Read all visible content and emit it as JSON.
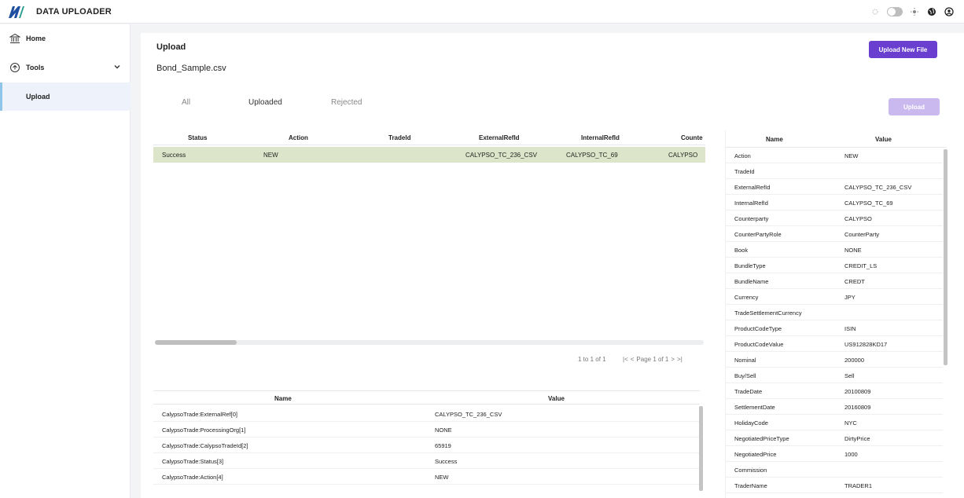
{
  "app": {
    "title": "DATA UPLOADER"
  },
  "sidebar": {
    "items": [
      {
        "label": "Home",
        "icon": "home-icon"
      },
      {
        "label": "Tools",
        "icon": "tools-icon"
      },
      {
        "label": "Upload",
        "active": true
      }
    ]
  },
  "page": {
    "title": "Upload",
    "file_name": "Bond_Sample.csv",
    "upload_new_label": "Upload New File",
    "upload_label": "Upload"
  },
  "tabs": [
    {
      "label": "All"
    },
    {
      "label": "Uploaded",
      "active": true
    },
    {
      "label": "Rejected"
    }
  ],
  "grid": {
    "columns": [
      "Status",
      "Action",
      "TradeId",
      "ExternalRefId",
      "InternalRefId",
      "Counte"
    ],
    "rows": [
      {
        "status": "Success",
        "action": "NEW",
        "trade_id": "",
        "external_ref": "CALYPSO_TC_236_CSV",
        "internal_ref": "CALYPSO_TC_69",
        "counterparty": "CALYPSO"
      }
    ]
  },
  "pager": {
    "count_text": "1 to 1 of 1",
    "first": "|<",
    "prev": "<",
    "page_text": "Page 1 of 1",
    "next": ">",
    "last": ">|"
  },
  "detail_table": {
    "headers": [
      "Name",
      "Value"
    ],
    "rows": [
      {
        "name": "CalypsoTrade:ExternalRef[0]",
        "value": "CALYPSO_TC_236_CSV"
      },
      {
        "name": "CalypsoTrade:ProcessingOrg[1]",
        "value": "NONE"
      },
      {
        "name": "CalypsoTrade:CalypsoTradeId[2]",
        "value": "65919"
      },
      {
        "name": "CalypsoTrade:Status[3]",
        "value": "Success"
      },
      {
        "name": "CalypsoTrade:Action[4]",
        "value": "NEW"
      }
    ]
  },
  "properties": {
    "headers": [
      "Name",
      "Value"
    ],
    "rows": [
      {
        "name": "Action",
        "value": "NEW"
      },
      {
        "name": "TradeId",
        "value": ""
      },
      {
        "name": "ExternalRefId",
        "value": "CALYPSO_TC_236_CSV"
      },
      {
        "name": "InternalRefId",
        "value": "CALYPSO_TC_69"
      },
      {
        "name": "Counterparty",
        "value": "CALYPSO"
      },
      {
        "name": "CounterPartyRole",
        "value": "CounterParty"
      },
      {
        "name": "Book",
        "value": "NONE"
      },
      {
        "name": "BundleType",
        "value": "CREDIT_LS"
      },
      {
        "name": "BundleName",
        "value": "CREDT"
      },
      {
        "name": "Currency",
        "value": "JPY"
      },
      {
        "name": "TradeSettlementCurrency",
        "value": ""
      },
      {
        "name": "ProductCodeType",
        "value": "ISIN"
      },
      {
        "name": "ProductCodeValue",
        "value": "US912828KD17"
      },
      {
        "name": "Nominal",
        "value": "200000"
      },
      {
        "name": "Buy/Sell",
        "value": "Sell"
      },
      {
        "name": "TradeDate",
        "value": "20100809"
      },
      {
        "name": "SettlementDate",
        "value": "20160809"
      },
      {
        "name": "HolidayCode",
        "value": "NYC"
      },
      {
        "name": "NegotiatedPriceType",
        "value": "DirtyPrice"
      },
      {
        "name": "NegotiatedPrice",
        "value": "1000"
      },
      {
        "name": "Commission",
        "value": ""
      },
      {
        "name": "TraderName",
        "value": "TRADER1"
      }
    ]
  },
  "colors": {
    "accent": "#6a3fd0",
    "accent_disabled": "#c9b9ef",
    "selected_row": "#dce5c9",
    "active_nav": "#eef2fa"
  }
}
